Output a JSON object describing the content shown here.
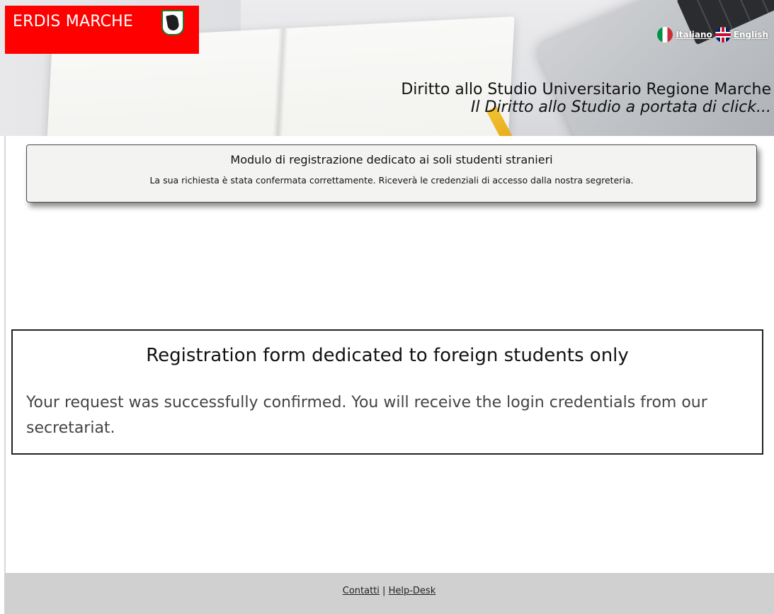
{
  "header": {
    "logo_text": "ERDIS MARCHE",
    "languages": {
      "italian": "Italiano",
      "english": "English"
    },
    "tagline_main": "Diritto allo Studio Universitario Regione Marche",
    "tagline_sub": "Il Diritto allo Studio a portata di click..."
  },
  "notice_it": {
    "title": "Modulo di registrazione dedicato ai soli studenti stranieri",
    "message": "La sua richiesta è stata confermata correttamente. Riceverà le credenziali di accesso dalla nostra segreteria."
  },
  "notice_en": {
    "title": "Registration form dedicated to foreign students only",
    "message": "Your request was successfully confirmed. You will receive the login credentials from our secretariat."
  },
  "footer": {
    "contacts": "Contatti",
    "separator": "|",
    "helpdesk": "Help-Desk"
  },
  "colors": {
    "brand_red": "#ff0000",
    "footer_bg": "#d0d0d0",
    "notice_bg": "#f3f4f2"
  }
}
